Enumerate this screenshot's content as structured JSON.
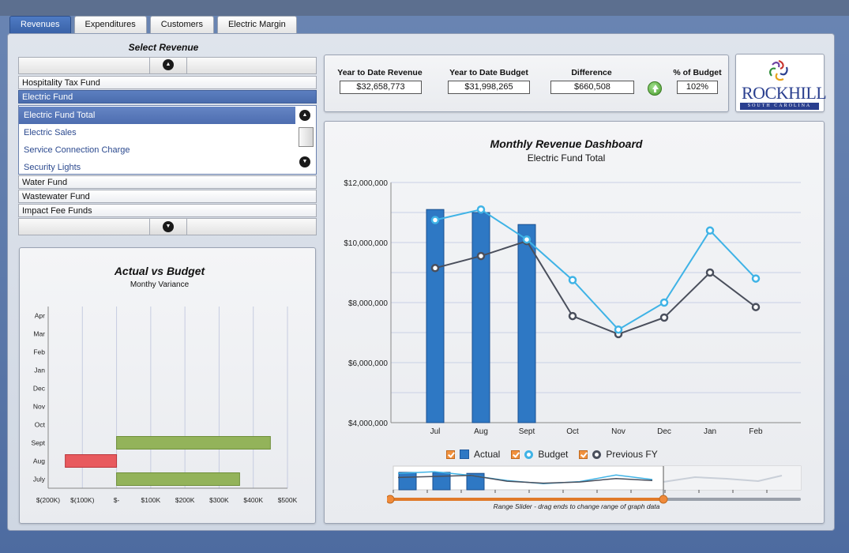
{
  "tabs": [
    {
      "label": "Revenues",
      "active": true
    },
    {
      "label": "Expenditures",
      "active": false
    },
    {
      "label": "Customers",
      "active": false
    },
    {
      "label": "Electric Margin",
      "active": false
    }
  ],
  "select_revenue": {
    "title": "Select Revenue",
    "funds_top": [
      "Hospitality Tax Fund",
      "Electric Fund"
    ],
    "selected_fund": "Electric Fund",
    "sub_items": [
      "Electric Fund Total",
      "Electric Sales",
      "Service Connection Charge",
      "Security Lights"
    ],
    "selected_sub_item": "Electric Fund Total",
    "funds_bottom": [
      "Water Fund",
      "Wastewater Fund",
      "Impact Fee Funds"
    ]
  },
  "kpis": {
    "ytd_revenue_label": "Year to Date Revenue",
    "ytd_revenue": "$32,658,773",
    "ytd_budget_label": "Year to Date Budget",
    "ytd_budget": "$31,998,265",
    "difference_label": "Difference",
    "difference": "$660,508",
    "pct_budget_label": "% of Budget",
    "pct_budget": "102%",
    "trend_icon": "up-arrow-icon",
    "trend_color": "#4a9a2f"
  },
  "logo": {
    "text": "ROCKHILL",
    "sub": "SOUTH CAROLINA"
  },
  "colors": {
    "actual": "#2e78c4",
    "budget": "#3fb3e6",
    "previous": "#4a4f5c",
    "positive": "#93b35a",
    "negative": "#e85a5e",
    "accent_tab": "#3a62a8"
  },
  "chart_data": [
    {
      "type": "bar",
      "orientation": "horizontal",
      "title": "Actual vs Budget",
      "subtitle": "Monthy Variance",
      "categories": [
        "July",
        "Aug",
        "Sept",
        "Oct",
        "Nov",
        "Dec",
        "Jan",
        "Feb",
        "Mar",
        "Apr"
      ],
      "values": [
        360000,
        -150000,
        450000,
        null,
        null,
        null,
        null,
        null,
        null,
        null
      ],
      "x_ticks": [
        "$(200K)",
        "$(100K)",
        "$-",
        "$100K",
        "$200K",
        "$300K",
        "$400K",
        "$500K"
      ],
      "xlim": [
        -200000,
        500000
      ],
      "grid": true
    },
    {
      "type": "bar",
      "combo": "bar+line",
      "title": "Monthly Revenue Dashboard",
      "subtitle": "Electric Fund Total",
      "categories": [
        "Jul",
        "Aug",
        "Sept",
        "Oct",
        "Nov",
        "Dec",
        "Jan",
        "Feb"
      ],
      "y_ticks": [
        "$4,000,000",
        "$6,000,000",
        "$8,000,000",
        "$10,000,000",
        "$12,000,000"
      ],
      "ylim": [
        4000000,
        12000000
      ],
      "grid": true,
      "legend_position": "bottom",
      "series": [
        {
          "name": "Actual",
          "kind": "bar",
          "values": [
            11100000,
            11000000,
            10600000,
            null,
            null,
            null,
            null,
            null
          ]
        },
        {
          "name": "Budget",
          "kind": "line",
          "values": [
            10750000,
            11100000,
            10100000,
            8750000,
            7100000,
            8000000,
            10400000,
            8800000
          ]
        },
        {
          "name": "Previous FY",
          "kind": "line",
          "values": [
            9150000,
            9550000,
            10050000,
            7550000,
            6950000,
            7500000,
            9000000,
            7850000
          ]
        }
      ]
    }
  ],
  "range_slider": {
    "label": "Range Slider - drag ends to change range of graph data"
  }
}
